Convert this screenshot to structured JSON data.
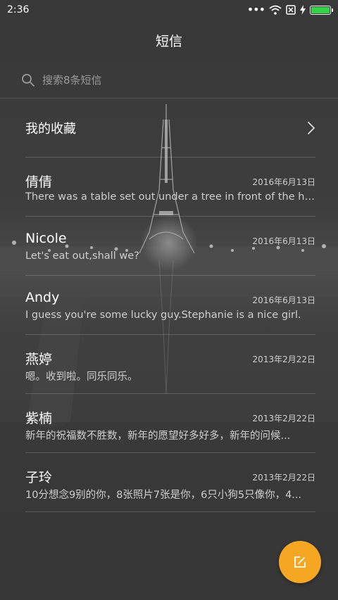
{
  "status_bar": {
    "time": "2:36",
    "more_dots": "•••",
    "battery_level": 1.0,
    "battery_color": "#36d34a",
    "icons": [
      "wifi-icon",
      "no-sim-icon",
      "charging-bolt-icon",
      "battery-icon"
    ]
  },
  "header": {
    "title": "短信"
  },
  "search": {
    "placeholder": "搜索8条短信",
    "icon": "search-icon"
  },
  "favorites": {
    "label": "我的收藏",
    "icon": "chevron-right-icon"
  },
  "messages": [
    {
      "name": "倩倩",
      "date": "2016年6月13日",
      "preview": "There was a table set out under a tree in front of the ho..."
    },
    {
      "name": "Nicole",
      "date": "2016年6月13日",
      "preview": "Let's eat out,shall we?"
    },
    {
      "name": "Andy",
      "date": "2016年6月13日",
      "preview": "I guess you're some lucky guy.Stephanie is a nice girl."
    },
    {
      "name": "燕婷",
      "date": "2013年2月22日",
      "preview": "嗯。收到啦。同乐同乐。"
    },
    {
      "name": "紫楠",
      "date": "2013年2月22日",
      "preview": "新年的祝福数不胜数，新年的愿望好多好多，新年的问候..."
    },
    {
      "name": "子玲",
      "date": "2013年2月22日",
      "preview": "10分想念9别的你，8张照片7张是你，6只小狗5只像你，4..."
    }
  ],
  "fab": {
    "icon": "compose-icon",
    "color": "#f5a623"
  }
}
